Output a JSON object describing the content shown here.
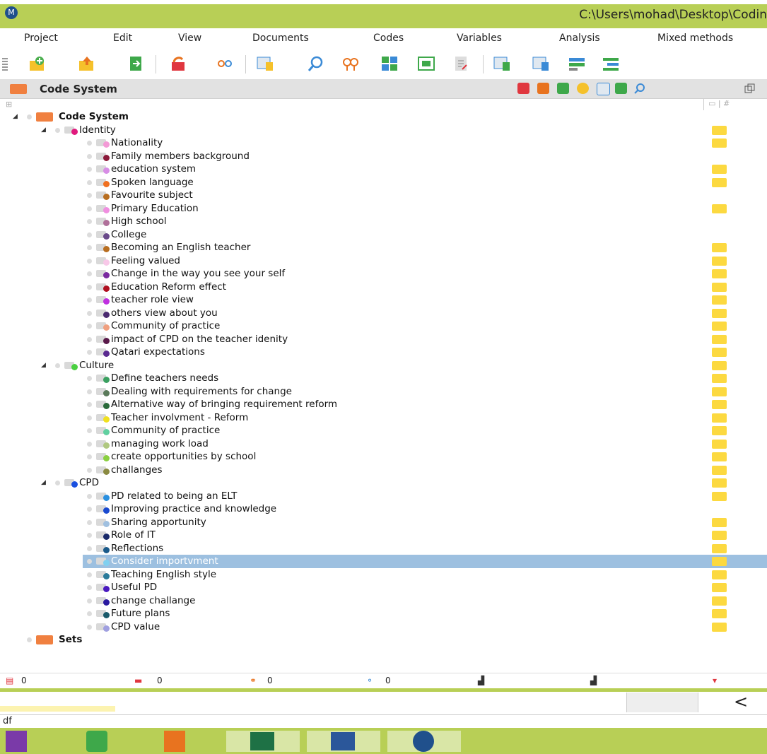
{
  "window": {
    "path": "C:\\Users\\mohad\\Desktop\\Codin"
  },
  "menu": [
    "Project",
    "Edit",
    "View",
    "Documents",
    "Codes",
    "Variables",
    "Analysis",
    "Mixed methods"
  ],
  "panel": {
    "title": "Code System"
  },
  "tree": [
    {
      "label": "Code System",
      "level": 0,
      "expanded": true,
      "root": true,
      "color": "#f08040",
      "memo": false
    },
    {
      "label": "Identity",
      "level": 1,
      "expanded": true,
      "color": "#e0197d",
      "memo": true
    },
    {
      "label": "Nationality",
      "level": 2,
      "color": "#f39ad6",
      "memo": true
    },
    {
      "label": "Family members background",
      "level": 2,
      "color": "#8b1a3a",
      "memo": false
    },
    {
      "label": "education system",
      "level": 2,
      "color": "#d88ee6",
      "memo": true
    },
    {
      "label": "Spoken language",
      "level": 2,
      "color": "#f07020",
      "memo": true
    },
    {
      "label": "Favourite subject",
      "level": 2,
      "color": "#b86e20",
      "memo": false
    },
    {
      "label": "Primary Education",
      "level": 2,
      "color": "#f08fe0",
      "memo": true
    },
    {
      "label": "High school",
      "level": 2,
      "color": "#b0709a",
      "memo": false
    },
    {
      "label": "College",
      "level": 2,
      "color": "#6a4a8a",
      "memo": false
    },
    {
      "label": "Becoming an English teacher",
      "level": 2,
      "color": "#b86e20",
      "memo": true
    },
    {
      "label": "Feeling valued",
      "level": 2,
      "color": "#f8c8e8",
      "memo": true
    },
    {
      "label": "Change in the way you see your self",
      "level": 2,
      "color": "#7a2aa0",
      "memo": true
    },
    {
      "label": "Education Reform effect",
      "level": 2,
      "color": "#b01020",
      "memo": true
    },
    {
      "label": "teacher role view",
      "level": 2,
      "color": "#c030e0",
      "memo": true
    },
    {
      "label": "others view about you",
      "level": 2,
      "color": "#4a2a70",
      "memo": true
    },
    {
      "label": "Community of practice",
      "level": 2,
      "color": "#f0a080",
      "memo": true
    },
    {
      "label": "impact of CPD on the teacher idenity",
      "level": 2,
      "color": "#5a1a4a",
      "memo": true
    },
    {
      "label": "Qatari expectations",
      "level": 2,
      "color": "#5a2a90",
      "memo": true
    },
    {
      "label": "Culture",
      "level": 1,
      "expanded": true,
      "color": "#4ad040",
      "memo": true
    },
    {
      "label": "Define teachers needs",
      "level": 2,
      "color": "#3aa060",
      "memo": true
    },
    {
      "label": "Dealing with requirements for change",
      "level": 2,
      "color": "#5a7a5a",
      "memo": true
    },
    {
      "label": "Alternative way of bringing requirement reform",
      "level": 2,
      "color": "#2a6a3a",
      "memo": true
    },
    {
      "label": "Teacher involvment - Reform",
      "level": 2,
      "color": "#f0e020",
      "memo": true
    },
    {
      "label": "Community of practice",
      "level": 2,
      "color": "#60d0a0",
      "memo": true
    },
    {
      "label": "managing work load",
      "level": 2,
      "color": "#b0c880",
      "memo": true
    },
    {
      "label": "create opportunities by school",
      "level": 2,
      "color": "#8ad040",
      "memo": true
    },
    {
      "label": "challanges",
      "level": 2,
      "color": "#8a8a40",
      "memo": true
    },
    {
      "label": "CPD",
      "level": 1,
      "expanded": true,
      "color": "#1a50e0",
      "memo": true
    },
    {
      "label": "PD related to being an ELT",
      "level": 2,
      "color": "#2a90e0",
      "memo": true
    },
    {
      "label": "Improving practice and knowledge",
      "level": 2,
      "color": "#1a4ad0",
      "memo": false
    },
    {
      "label": "Sharing apportunity",
      "level": 2,
      "color": "#a0c0e0",
      "memo": true
    },
    {
      "label": "Role of IT",
      "level": 2,
      "color": "#1a2a6a",
      "memo": true
    },
    {
      "label": "Reflections",
      "level": 2,
      "color": "#1a5a8a",
      "memo": true
    },
    {
      "label": "Consider importvment",
      "level": 2,
      "color": "#80d0f0",
      "memo": true,
      "selected": true
    },
    {
      "label": "Teaching English style",
      "level": 2,
      "color": "#2a7a9a",
      "memo": true
    },
    {
      "label": "Useful PD",
      "level": 2,
      "color": "#4a1ac0",
      "memo": true
    },
    {
      "label": "change challange",
      "level": 2,
      "color": "#2a1aa0",
      "memo": true
    },
    {
      "label": "Future plans",
      "level": 2,
      "color": "#1a5a6a",
      "memo": true
    },
    {
      "label": "CPD value",
      "level": 2,
      "color": "#a0a0e0",
      "memo": true
    },
    {
      "label": "Sets",
      "level": 0,
      "root": true,
      "sets": true,
      "color": "#f08040",
      "memo": false
    }
  ],
  "status": {
    "documents": "0",
    "codes": "0",
    "memos": "0",
    "variables": "0"
  },
  "bottom": {
    "label": "df"
  }
}
